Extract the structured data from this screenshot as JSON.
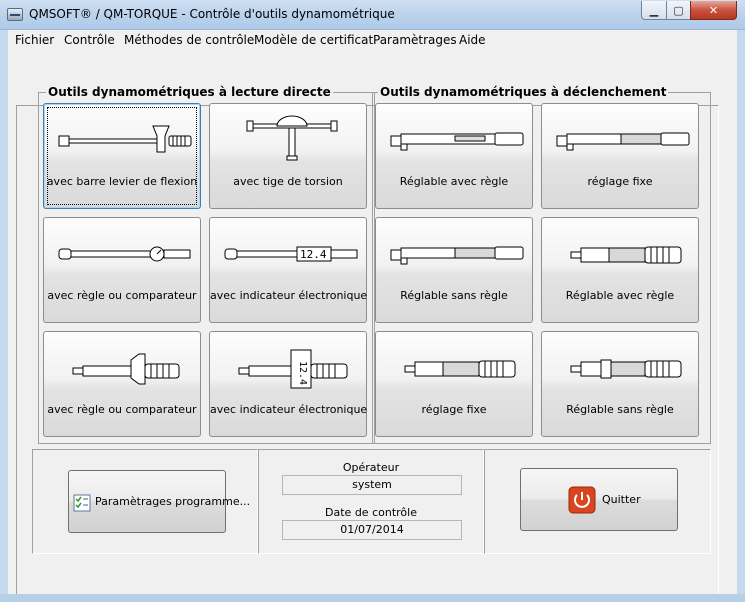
{
  "window": {
    "title": "QMSOFT® / QM-TORQUE - Contrôle d'outils dynamométrique",
    "minimize_glyph": "▁",
    "maximize_glyph": "▢",
    "close_glyph": "✕"
  },
  "menu": [
    "Fichier",
    "Contrôle",
    "Méthodes de contrôle",
    "Modèle de certificat",
    "Paramètrages",
    "Aide"
  ],
  "groups": {
    "direct": {
      "label": "Outils dynamométriques à lecture directe",
      "tools": [
        {
          "label": "avec barre levier de flexion",
          "icon": "flex-beam-wrench-icon"
        },
        {
          "label": "avec tige de torsion",
          "icon": "torsion-bar-wrench-icon"
        },
        {
          "label": "avec règle ou comparateur",
          "icon": "dial-gauge-wrench-icon"
        },
        {
          "label": "avec indicateur électronique",
          "icon": "digital-display-wrench-icon",
          "display": "12.4"
        },
        {
          "label": "avec règle ou comparateur",
          "icon": "dial-gauge-screwdriver-icon"
        },
        {
          "label": "avec indicateur électronique",
          "icon": "digital-display-screwdriver-icon",
          "display": "12.4"
        }
      ]
    },
    "click": {
      "label": "Outils dynamométriques à déclenchement",
      "tools": [
        {
          "label": "Réglable avec règle",
          "icon": "adjustable-scale-wrench-icon"
        },
        {
          "label": "réglage fixe",
          "icon": "fixed-setting-wrench-icon"
        },
        {
          "label": "Réglable sans règle",
          "icon": "adjustable-noscale-wrench-icon"
        },
        {
          "label": "Réglable avec règle",
          "icon": "adjustable-scale-screwdriver-icon"
        },
        {
          "label": "réglage fixe",
          "icon": "fixed-setting-screwdriver-icon"
        },
        {
          "label": "Réglable sans règle",
          "icon": "adjustable-noscale-screwdriver-icon"
        }
      ]
    }
  },
  "bottom": {
    "settings_button": "Paramètrages programme...",
    "operator_label": "Opérateur",
    "operator_value": "system",
    "date_label": "Date de contrôle",
    "date_value": "01/07/2014",
    "quit_button": "Quitter"
  },
  "colors": {
    "quit_icon": "#d9451f",
    "focus_border": "#3c7fb1"
  }
}
